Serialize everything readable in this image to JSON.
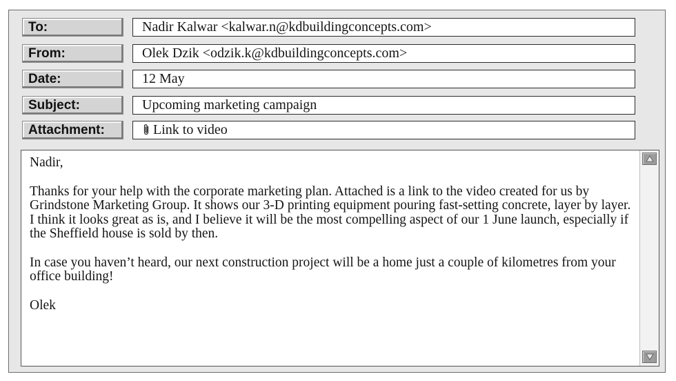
{
  "header": {
    "fields": [
      {
        "label": "To:",
        "value": "Nadir Kalwar <kalwar.n@kdbuildingconcepts.com>"
      },
      {
        "label": "From:",
        "value": "Olek Dzik <odzik.k@kdbuildingconcepts.com>"
      },
      {
        "label": "Date:",
        "value": "12 May"
      },
      {
        "label": "Subject:",
        "value": "Upcoming marketing campaign"
      },
      {
        "label": "Attachment:",
        "value": "Link to video",
        "icon": "paperclip-icon"
      }
    ]
  },
  "body": {
    "paragraphs": [
      "Nadir,",
      "Thanks for your help with the corporate marketing plan. Attached is a link to the video created for us by Grindstone Marketing Group. It shows our 3-D printing equipment pouring fast-setting concrete, layer by layer. I think it looks great as is, and I believe it will be the most compelling aspect of our 1 June launch, especially if the Sheffield house is sold by then.",
      "In case you haven’t heard, our next construction project will be a home just a couple of kilometres from your office building!",
      "Olek"
    ]
  },
  "colors": {
    "window_bg": "#e7e7e7",
    "label_bg": "#d4d4d4",
    "scroll_button": "#9c9c9c"
  }
}
